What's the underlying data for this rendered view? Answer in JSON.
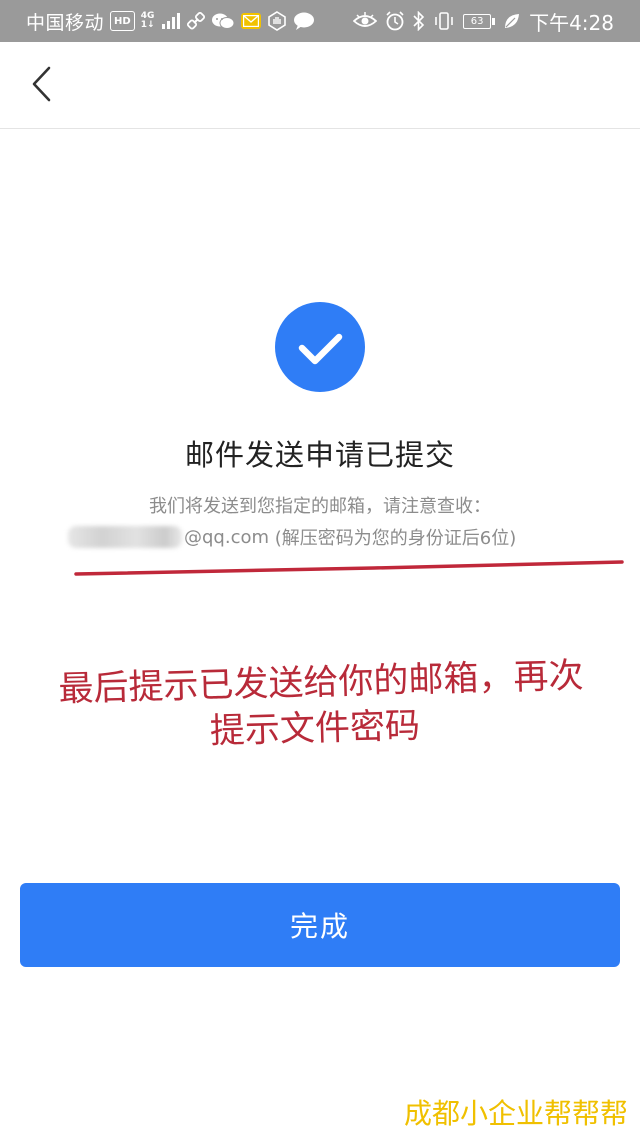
{
  "status_bar": {
    "carrier": "中国移动",
    "hd_badge": "HD",
    "network_top": "4G",
    "network_bottom": "1↓",
    "battery": "63",
    "time": "下午4:28",
    "icons": [
      "hd-icon",
      "signal-icon",
      "link-icon",
      "wechat-icon",
      "mail-icon",
      "hand-icon",
      "message-bubble-icon",
      "eye-icon",
      "alarm-icon",
      "bluetooth-icon",
      "vibrate-icon",
      "battery-icon",
      "leaf-icon"
    ]
  },
  "nav": {
    "back_icon": "chevron-left-icon"
  },
  "success": {
    "icon": "check-circle-icon",
    "icon_color": "#2f7df6",
    "title": "邮件发送申请已提交",
    "description_line1": "我们将发送到您指定的邮箱，请注意查收：",
    "email_suffix": "@qq.com",
    "password_hint": "(解压密码为您的身份证后6位)"
  },
  "annotation": {
    "line1": "最后提示已发送给你的邮箱，再次",
    "line2": "提示文件密码",
    "color": "#b82a39"
  },
  "actions": {
    "done_label": "完成",
    "button_color": "#2f7df6"
  },
  "watermark": {
    "text": "成都小企业帮帮帮",
    "color": "#f0c000"
  }
}
